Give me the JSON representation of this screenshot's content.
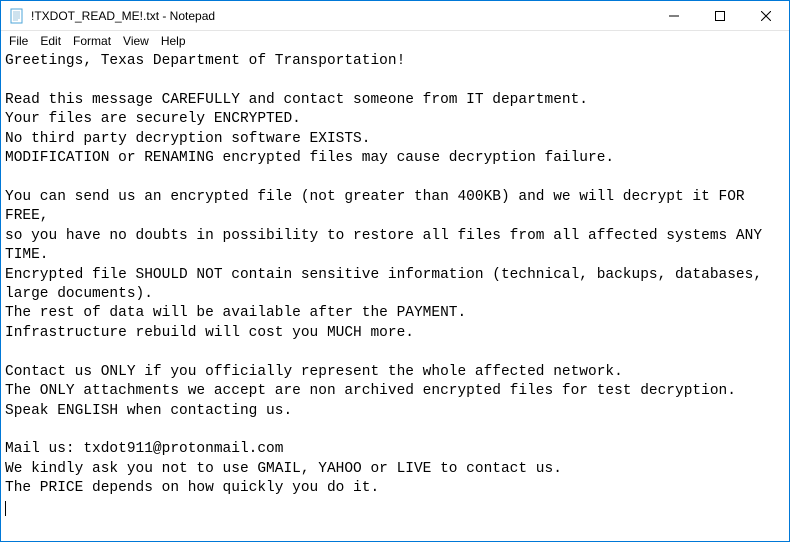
{
  "window": {
    "title": "!TXDOT_READ_ME!.txt - Notepad"
  },
  "menu": {
    "file": "File",
    "edit": "Edit",
    "format": "Format",
    "view": "View",
    "help": "Help"
  },
  "document": {
    "text": "Greetings, Texas Department of Transportation!\n\nRead this message CAREFULLY and contact someone from IT department.\nYour files are securely ENCRYPTED.\nNo third party decryption software EXISTS.\nMODIFICATION or RENAMING encrypted files may cause decryption failure.\n\nYou can send us an encrypted file (not greater than 400KB) and we will decrypt it FOR FREE,\nso you have no doubts in possibility to restore all files from all affected systems ANY TIME.\nEncrypted file SHOULD NOT contain sensitive information (technical, backups, databases, large documents).\nThe rest of data will be available after the PAYMENT.\nInfrastructure rebuild will cost you MUCH more.\n\nContact us ONLY if you officially represent the whole affected network.\nThe ONLY attachments we accept are non archived encrypted files for test decryption.\nSpeak ENGLISH when contacting us.\n\nMail us: txdot911@protonmail.com\nWe kindly ask you not to use GMAIL, YAHOO or LIVE to contact us.\nThe PRICE depends on how quickly you do it."
  }
}
